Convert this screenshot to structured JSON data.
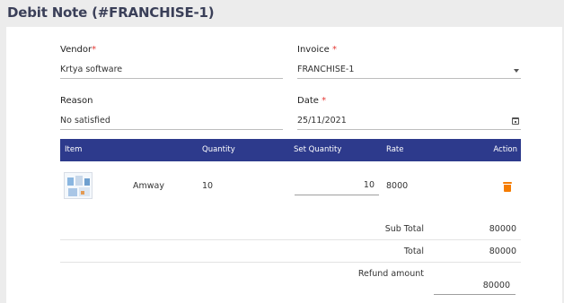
{
  "page": {
    "title": "Debit Note (#FRANCHISE-1)"
  },
  "form": {
    "vendor": {
      "label": "Vendor",
      "required_mark": "*",
      "value": "Krtya software"
    },
    "invoice": {
      "label": "Invoice",
      "required_mark": "*",
      "value": "FRANCHISE-1",
      "icon": "chevron-down-icon"
    },
    "reason": {
      "label": "Reason",
      "value": "No satisfied"
    },
    "date": {
      "label": "Date",
      "required_mark": "*",
      "value": "25/11/2021",
      "icon": "calendar-icon"
    }
  },
  "table": {
    "header_color": "#2d3a8c",
    "columns": [
      "Item",
      "Quantity",
      "Set Quantity",
      "Rate",
      "Action"
    ],
    "rows": [
      {
        "thumbnail": "product-thumbnail",
        "name": "Amway",
        "quantity": "10",
        "set_quantity": "10",
        "rate": "8000",
        "action_icon": "trash-icon"
      }
    ]
  },
  "totals": {
    "sub_total_label": "Sub Total",
    "sub_total": "80000",
    "total_label": "Total",
    "total": "80000",
    "refund_label": "Refund amount",
    "refund": "80000"
  },
  "colors": {
    "required": "#e53935",
    "delete_icon": "#f57c00"
  }
}
